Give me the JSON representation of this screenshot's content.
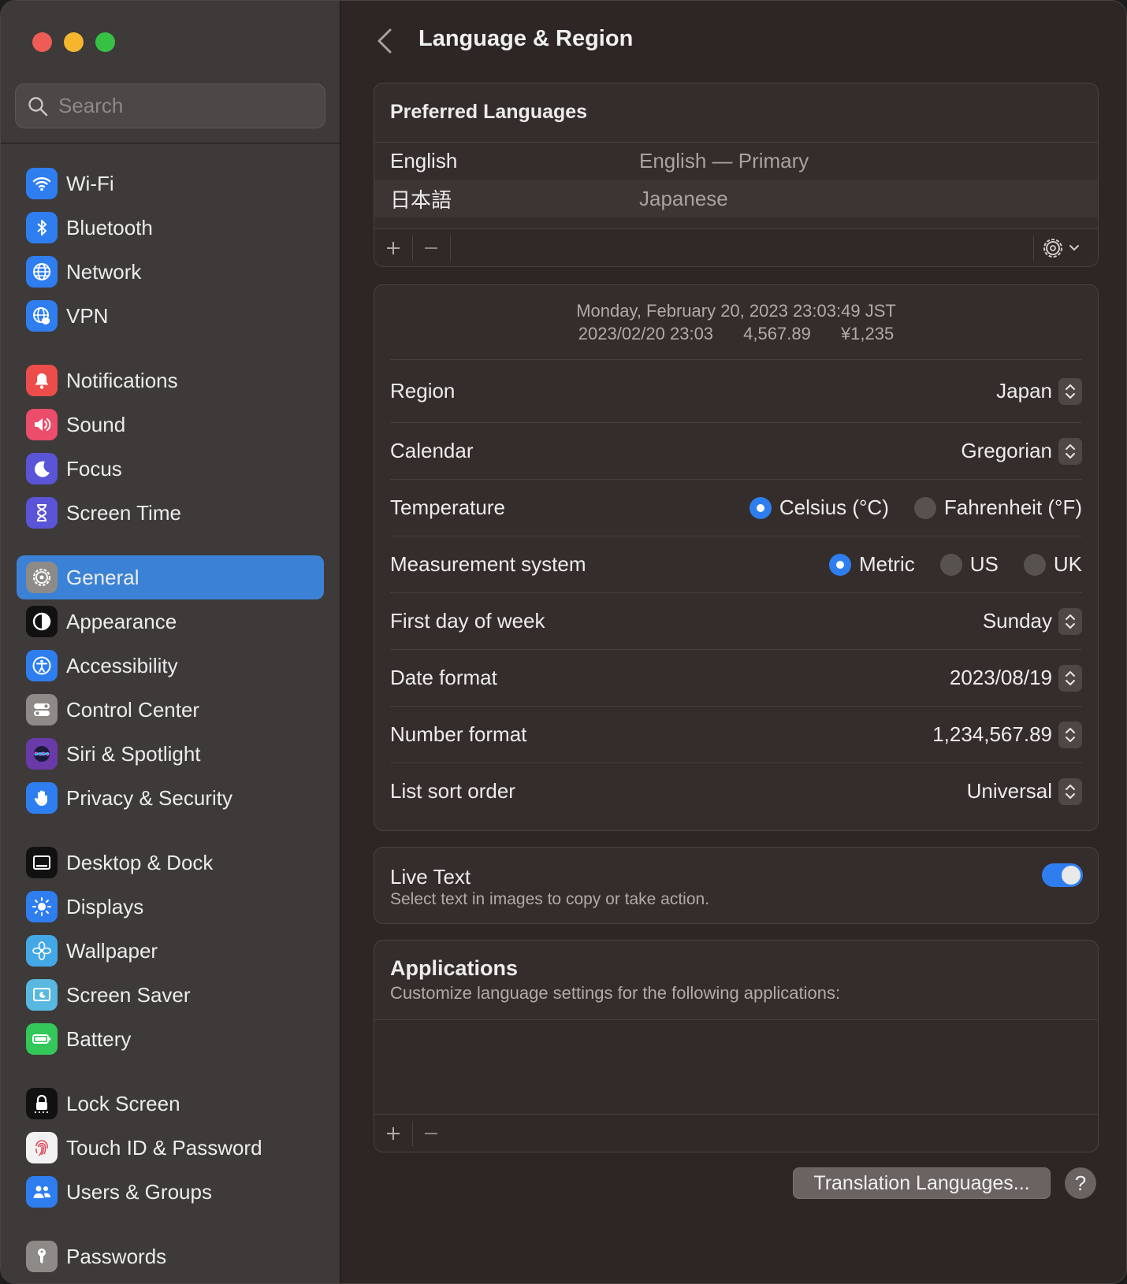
{
  "search": {
    "placeholder": "Search"
  },
  "sidebar": {
    "groups": [
      [
        {
          "label": "Wi-Fi",
          "icon": "wifi-icon",
          "color": "#2f7ef0"
        },
        {
          "label": "Bluetooth",
          "icon": "bluetooth-icon",
          "color": "#2f7ef0"
        },
        {
          "label": "Network",
          "icon": "globe-icon",
          "color": "#2f7ef0"
        },
        {
          "label": "VPN",
          "icon": "vpn-globe-icon",
          "color": "#2f7ef0"
        }
      ],
      [
        {
          "label": "Notifications",
          "icon": "bell-icon",
          "color": "#ec4d4b"
        },
        {
          "label": "Sound",
          "icon": "speaker-icon",
          "color": "#ec4d6a"
        },
        {
          "label": "Focus",
          "icon": "moon-icon",
          "color": "#5a55d6"
        },
        {
          "label": "Screen Time",
          "icon": "hourglass-icon",
          "color": "#5a55d6"
        }
      ],
      [
        {
          "label": "General",
          "icon": "gear-icon",
          "color": "#8e8a88",
          "active": true
        },
        {
          "label": "Appearance",
          "icon": "appearance-icon",
          "color": "#111111"
        },
        {
          "label": "Accessibility",
          "icon": "accessibility-icon",
          "color": "#2f7ef0"
        },
        {
          "label": "Control Center",
          "icon": "toggles-icon",
          "color": "#8e8a88"
        },
        {
          "label": "Siri & Spotlight",
          "icon": "siri-icon",
          "color": "#6a3aa8"
        },
        {
          "label": "Privacy & Security",
          "icon": "hand-icon",
          "color": "#2f7ef0"
        }
      ],
      [
        {
          "label": "Desktop & Dock",
          "icon": "dock-icon",
          "color": "#111111"
        },
        {
          "label": "Displays",
          "icon": "sun-icon",
          "color": "#2f7ef0"
        },
        {
          "label": "Wallpaper",
          "icon": "flower-icon",
          "color": "#44a8e6"
        },
        {
          "label": "Screen Saver",
          "icon": "screensaver-icon",
          "color": "#58b8e0"
        },
        {
          "label": "Battery",
          "icon": "battery-icon",
          "color": "#34c759"
        }
      ],
      [
        {
          "label": "Lock Screen",
          "icon": "lock-icon",
          "color": "#111111"
        },
        {
          "label": "Touch ID & Password",
          "icon": "fingerprint-icon",
          "color": "#f2f2f2"
        },
        {
          "label": "Users & Groups",
          "icon": "users-icon",
          "color": "#2f7ef0"
        }
      ],
      [
        {
          "label": "Passwords",
          "icon": "key-icon",
          "color": "#8e8a88"
        }
      ]
    ]
  },
  "header": {
    "title": "Language & Region"
  },
  "preferred": {
    "title": "Preferred Languages",
    "languages": [
      {
        "name": "English",
        "detail": "English — Primary"
      },
      {
        "name": "日本語",
        "detail": "Japanese"
      }
    ]
  },
  "preview": {
    "line1": "Monday, February 20, 2023 23:03:49 JST",
    "date": "2023/02/20 23:03",
    "number": "4,567.89",
    "currency": "¥1,235"
  },
  "settings": {
    "region": {
      "label": "Region",
      "value": "Japan"
    },
    "calendar": {
      "label": "Calendar",
      "value": "Gregorian"
    },
    "temperature": {
      "label": "Temperature",
      "options": [
        "Celsius (°C)",
        "Fahrenheit (°F)"
      ],
      "selected": "Celsius (°C)"
    },
    "measurement": {
      "label": "Measurement system",
      "options": [
        "Metric",
        "US",
        "UK"
      ],
      "selected": "Metric"
    },
    "first_day": {
      "label": "First day of week",
      "value": "Sunday"
    },
    "date_format": {
      "label": "Date format",
      "value": "2023/08/19"
    },
    "number_format": {
      "label": "Number format",
      "value": "1,234,567.89"
    },
    "sort_order": {
      "label": "List sort order",
      "value": "Universal"
    }
  },
  "live_text": {
    "title": "Live Text",
    "subtitle": "Select text in images to copy or take action.",
    "enabled": true
  },
  "applications": {
    "title": "Applications",
    "subtitle": "Customize language settings for the following applications:"
  },
  "buttons": {
    "translation": "Translation Languages...",
    "help": "?"
  },
  "colors": {
    "accent": "#2f7ef0",
    "selection": "#3b82d6"
  }
}
